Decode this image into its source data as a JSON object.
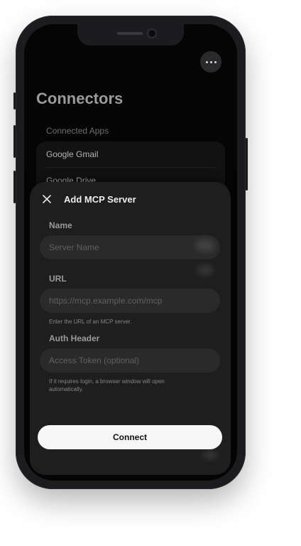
{
  "screen": {
    "title": "Connectors",
    "section_label": "Connected Apps",
    "connected_apps": [
      {
        "label": "Google Gmail"
      },
      {
        "label": "Google Drive"
      }
    ],
    "more_icon": "ellipsis-icon"
  },
  "sheet": {
    "title": "Add MCP Server",
    "close_icon": "close-icon",
    "name_label": "Name",
    "name_placeholder": "Server Name",
    "url_label": "URL",
    "url_placeholder": "https://mcp.example.com/mcp",
    "url_helper": "Enter the URL of an MCP server.",
    "auth_label": "Auth Header",
    "auth_placeholder": "Access Token (optional)",
    "auth_helper": "If it requires login, a browser window will open automatically.",
    "connect_label": "Connect"
  },
  "colors": {
    "screen_bg": "#050505",
    "sheet_bg": "#1e1e1f",
    "input_bg": "#2a2a2b",
    "button_bg": "#f6f6f6"
  }
}
